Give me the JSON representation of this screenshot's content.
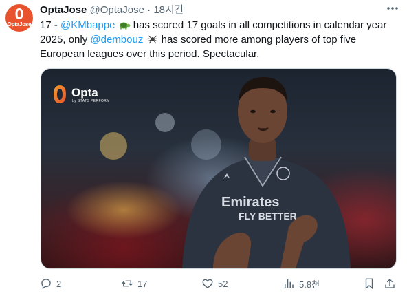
{
  "author": {
    "avatar_label": "OptaJose",
    "name": "OptaJose",
    "handle": "@OptaJose",
    "separator": "·",
    "time": "18시간"
  },
  "tweet": {
    "part1": "17 - ",
    "mention1": "@KMbappe",
    "part2": " has scored 17 goals in all competitions in calendar year 2025, only ",
    "mention2": "@dembouz",
    "part3": " has scored more among players of top five European leagues over this period. Spectacular."
  },
  "media": {
    "logo_brand": "Opta",
    "logo_sub": "by STATS PERFORM",
    "shirt_sponsor_line1": "Emirates",
    "shirt_sponsor_line2": "FLY BETTER"
  },
  "actions": {
    "replies": "2",
    "reposts": "17",
    "likes": "52",
    "views": "5.8천"
  },
  "colors": {
    "accent": "#1d9bf0",
    "muted": "#536471",
    "brand": "#e8532d"
  },
  "icons": [
    "more-icon",
    "turtle-emoji-icon",
    "spider-emoji-icon",
    "reply-icon",
    "repost-icon",
    "like-icon",
    "views-icon",
    "bookmark-icon",
    "share-icon"
  ]
}
